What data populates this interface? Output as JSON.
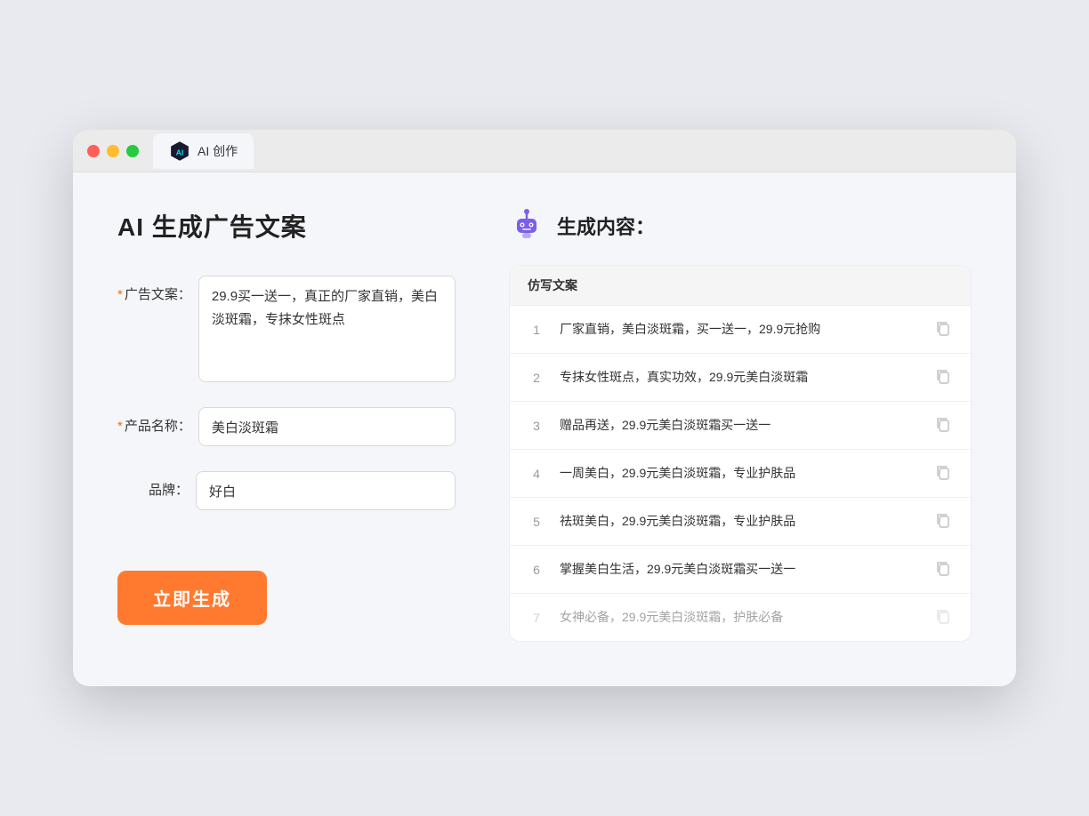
{
  "browser": {
    "tab_label": "AI 创作"
  },
  "page": {
    "title": "AI 生成广告文案",
    "result_section_title": "生成内容："
  },
  "form": {
    "ad_copy_label": "广告文案：",
    "ad_copy_required": "*",
    "ad_copy_value": "29.9买一送一，真正的厂家直销，美白淡斑霜，专抹女性斑点",
    "product_name_label": "产品名称：",
    "product_name_required": "*",
    "product_name_value": "美白淡斑霜",
    "brand_label": "品牌：",
    "brand_value": "好白",
    "generate_button": "立即生成"
  },
  "results": {
    "table_header": "仿写文案",
    "rows": [
      {
        "number": "1",
        "text": "厂家直销，美白淡斑霜，买一送一，29.9元抢购",
        "dimmed": false
      },
      {
        "number": "2",
        "text": "专抹女性斑点，真实功效，29.9元美白淡斑霜",
        "dimmed": false
      },
      {
        "number": "3",
        "text": "赠品再送，29.9元美白淡斑霜买一送一",
        "dimmed": false
      },
      {
        "number": "4",
        "text": "一周美白，29.9元美白淡斑霜，专业护肤品",
        "dimmed": false
      },
      {
        "number": "5",
        "text": "祛斑美白，29.9元美白淡斑霜，专业护肤品",
        "dimmed": false
      },
      {
        "number": "6",
        "text": "掌握美白生活，29.9元美白淡斑霜买一送一",
        "dimmed": false
      },
      {
        "number": "7",
        "text": "女神必备，29.9元美白淡斑霜，护肤必备",
        "dimmed": true
      }
    ]
  }
}
